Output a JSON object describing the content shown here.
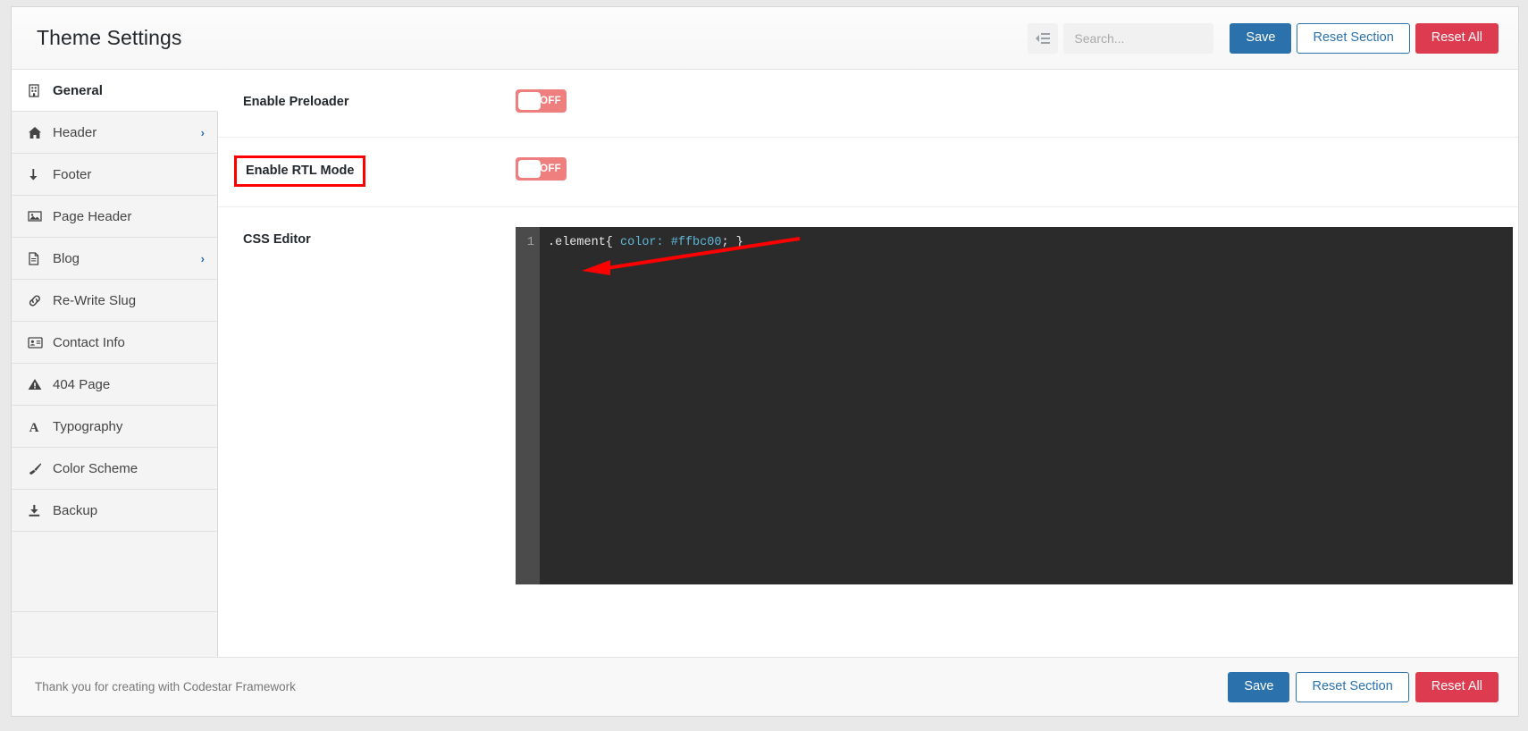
{
  "header": {
    "title": "Theme Settings",
    "collapse_icon": "indent-list-icon",
    "search": {
      "placeholder": "Search...",
      "value": ""
    },
    "buttons": {
      "save": "Save",
      "reset_section": "Reset Section",
      "reset_all": "Reset All"
    }
  },
  "sidebar": {
    "items": [
      {
        "label": "General",
        "icon": "building-icon",
        "active": true,
        "arrow": ""
      },
      {
        "label": "Header",
        "icon": "home-icon",
        "active": false,
        "arrow": "›"
      },
      {
        "label": "Footer",
        "icon": "arrow-down-icon",
        "active": false,
        "arrow": ""
      },
      {
        "label": "Page Header",
        "icon": "image-icon",
        "active": false,
        "arrow": ""
      },
      {
        "label": "Blog",
        "icon": "file-icon",
        "active": false,
        "arrow": "›"
      },
      {
        "label": "Re-Write Slug",
        "icon": "link-icon",
        "active": false,
        "arrow": ""
      },
      {
        "label": "Contact Info",
        "icon": "id-card-icon",
        "active": false,
        "arrow": ""
      },
      {
        "label": "404 Page",
        "icon": "warning-icon",
        "active": false,
        "arrow": ""
      },
      {
        "label": "Typography",
        "icon": "font-icon",
        "active": false,
        "arrow": ""
      },
      {
        "label": "Color Scheme",
        "icon": "paintbrush-icon",
        "active": false,
        "arrow": ""
      },
      {
        "label": "Backup",
        "icon": "download-icon",
        "active": false,
        "arrow": ""
      }
    ]
  },
  "main": {
    "fields": [
      {
        "title": "Enable Preloader",
        "type": "switcher",
        "state": "OFF",
        "highlighted": false
      },
      {
        "title": "Enable RTL Mode",
        "type": "switcher",
        "state": "OFF",
        "highlighted": true
      },
      {
        "title": "CSS Editor",
        "type": "code",
        "line_number": "1"
      }
    ],
    "code": {
      "selector": ".element{",
      "property": " color:",
      "value": " #ffbc00",
      "terminator": "; }",
      "accent_color": "#ffbc00"
    }
  },
  "footer": {
    "note": "Thank you for creating with Codestar Framework",
    "buttons": {
      "save": "Save",
      "reset_section": "Reset Section",
      "reset_all": "Reset All"
    }
  },
  "annotation": {
    "arrow_color": "#ff0000",
    "box_color": "#ff0000"
  },
  "colors": {
    "primary": "#2b72ac",
    "danger": "#dd3b4f",
    "switch_off": "#ef7e7e",
    "editor_bg": "#2b2b2b"
  }
}
